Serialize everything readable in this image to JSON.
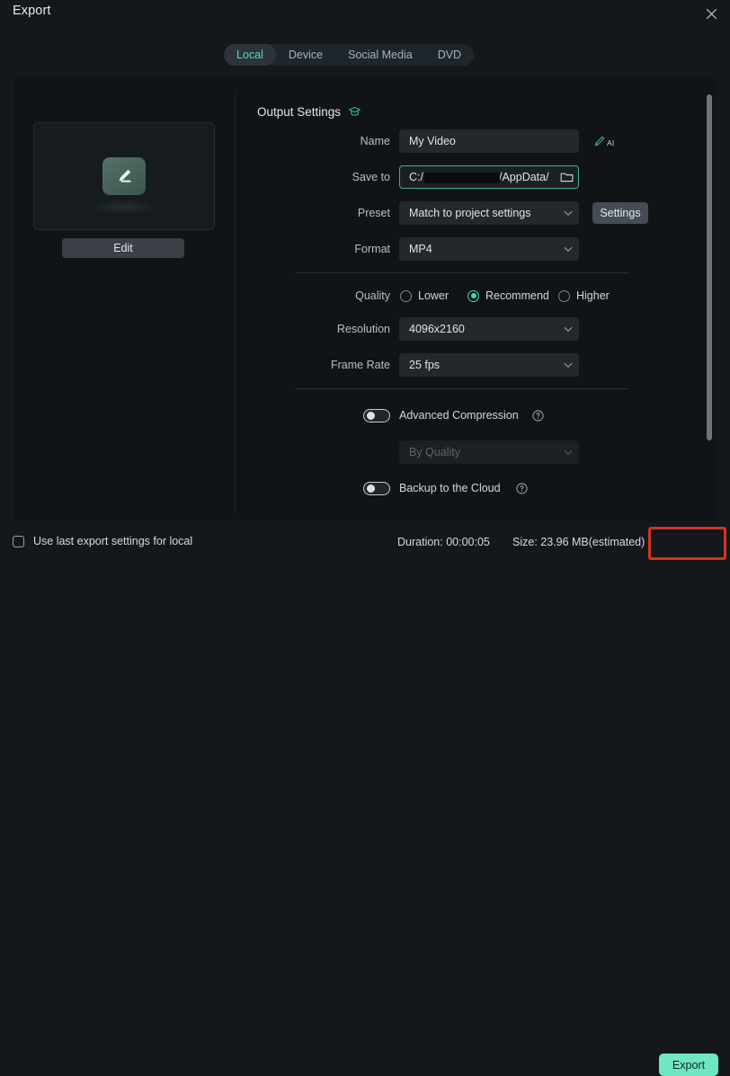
{
  "window": {
    "title": "Export",
    "close_icon": "close-icon"
  },
  "tabs": [
    {
      "label": "Local",
      "active": true
    },
    {
      "label": "Device",
      "active": false
    },
    {
      "label": "Social Media",
      "active": false
    },
    {
      "label": "DVD",
      "active": false
    }
  ],
  "preview": {
    "thumbnail_icon": "pencil-edit-icon",
    "edit_label": "Edit"
  },
  "output_settings": {
    "title": "Output Settings",
    "tutorial_icon": "graduation-cap-icon",
    "name": {
      "label": "Name",
      "value": "My Video",
      "ai_icon": "ai-pen-icon",
      "ai_text": "AI"
    },
    "save_to": {
      "label": "Save to",
      "value_prefix": "C:/",
      "value_suffix": "/AppData/",
      "redacted": true,
      "folder_icon": "folder-icon"
    },
    "preset": {
      "label": "Preset",
      "value": "Match to project settings",
      "settings_button": "Settings"
    },
    "format": {
      "label": "Format",
      "value": "MP4"
    }
  },
  "quality": {
    "label": "Quality",
    "options": [
      {
        "label": "Lower",
        "selected": false
      },
      {
        "label": "Recommend",
        "selected": true
      },
      {
        "label": "Higher",
        "selected": false
      }
    ]
  },
  "resolution": {
    "label": "Resolution",
    "value": "4096x2160"
  },
  "frame_rate": {
    "label": "Frame Rate",
    "value": "25 fps"
  },
  "advanced_compression": {
    "label": "Advanced Compression",
    "enabled": false,
    "help_icon": "question-mark-icon",
    "mode_value": "By Quality",
    "mode_disabled": true
  },
  "backup_cloud": {
    "label": "Backup to the Cloud",
    "enabled": false,
    "help_icon": "question-mark-icon"
  },
  "footer": {
    "use_last_settings_label": "Use last export settings for local",
    "use_last_settings_checked": false,
    "duration": "Duration: 00:00:05",
    "size": "Size: 23.96 MB(estimated)",
    "export_label": "Export"
  },
  "colors": {
    "accent_teal": "#4fdec0",
    "export_green": "#6ee7c2",
    "highlight_red": "#d6341c",
    "panel_bg": "#101417",
    "window_bg": "#14181c"
  }
}
